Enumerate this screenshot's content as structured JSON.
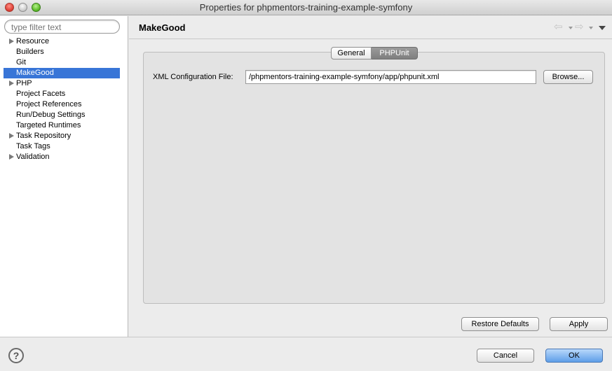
{
  "window": {
    "title": "Properties for phpmentors-training-example-symfony"
  },
  "sidebar": {
    "filter_placeholder": "type filter text",
    "items": [
      {
        "label": "Resource",
        "expandable": true,
        "selected": false
      },
      {
        "label": "Builders",
        "expandable": false,
        "selected": false
      },
      {
        "label": "Git",
        "expandable": false,
        "selected": false
      },
      {
        "label": "MakeGood",
        "expandable": false,
        "selected": true
      },
      {
        "label": "PHP",
        "expandable": true,
        "selected": false
      },
      {
        "label": "Project Facets",
        "expandable": false,
        "selected": false
      },
      {
        "label": "Project References",
        "expandable": false,
        "selected": false
      },
      {
        "label": "Run/Debug Settings",
        "expandable": false,
        "selected": false
      },
      {
        "label": "Targeted Runtimes",
        "expandable": false,
        "selected": false
      },
      {
        "label": "Task Repository",
        "expandable": true,
        "selected": false
      },
      {
        "label": "Task Tags",
        "expandable": false,
        "selected": false
      },
      {
        "label": "Validation",
        "expandable": true,
        "selected": false
      }
    ]
  },
  "main": {
    "title": "MakeGood",
    "tabs": [
      {
        "label": "General",
        "active": false
      },
      {
        "label": "PHPUnit",
        "active": true
      }
    ],
    "xml_config": {
      "label": "XML Configuration File:",
      "value": "/phpmentors-training-example-symfony/app/phpunit.xml",
      "browse_label": "Browse..."
    },
    "restore_defaults_label": "Restore Defaults",
    "apply_label": "Apply"
  },
  "footer": {
    "help_symbol": "?",
    "cancel_label": "Cancel",
    "ok_label": "OK"
  },
  "icons": {
    "back": "back-arrow-icon",
    "forward": "forward-arrow-icon",
    "view_menu": "view-menu-icon",
    "help": "help-icon"
  },
  "colors": {
    "selection": "#3875d7",
    "default_button": "#5e9ee8",
    "active_tab": "#8a8a8a"
  }
}
